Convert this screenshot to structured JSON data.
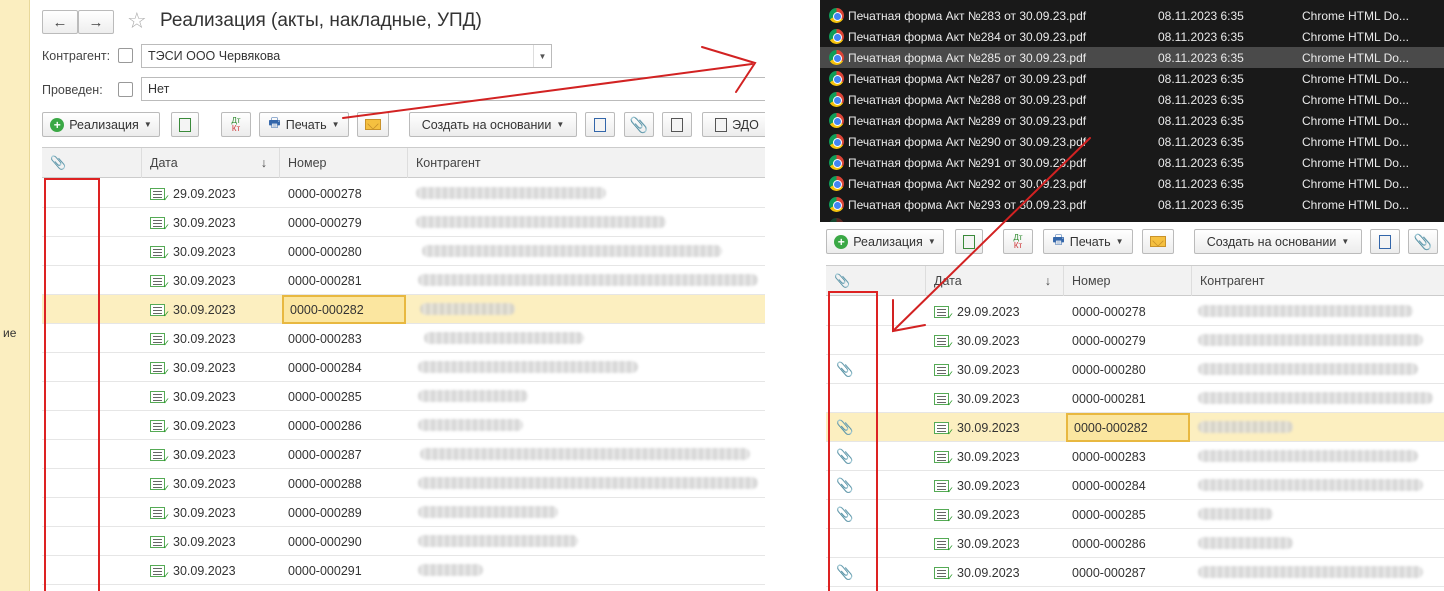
{
  "left": {
    "strip_text": "ие",
    "nav": {
      "back": "←",
      "forward": "→"
    },
    "title": "Реализация (акты, накладные, УПД)",
    "filters": {
      "kontragent_label": "Контрагент:",
      "kontragent_value": "ТЭСИ ООО Червякова",
      "provoden_label": "Проведен:",
      "provoden_value": "Нет"
    },
    "toolbar": {
      "realization": "Реализация",
      "dt": "Дт",
      "kt": "Кт",
      "print": "Печать",
      "create_basis": "Создать на основании",
      "edo": "ЭДО"
    },
    "columns": {
      "date": "Дата",
      "sort_arrow": "↓",
      "number": "Номер",
      "kontragent": "Контрагент"
    },
    "rows": [
      {
        "date": "29.09.2023",
        "number": "0000-000278"
      },
      {
        "date": "30.09.2023",
        "number": "0000-000279"
      },
      {
        "date": "30.09.2023",
        "number": "0000-000280"
      },
      {
        "date": "30.09.2023",
        "number": "0000-000281"
      },
      {
        "date": "30.09.2023",
        "number": "0000-000282"
      },
      {
        "date": "30.09.2023",
        "number": "0000-000283"
      },
      {
        "date": "30.09.2023",
        "number": "0000-000284"
      },
      {
        "date": "30.09.2023",
        "number": "0000-000285"
      },
      {
        "date": "30.09.2023",
        "number": "0000-000286"
      },
      {
        "date": "30.09.2023",
        "number": "0000-000287"
      },
      {
        "date": "30.09.2023",
        "number": "0000-000288"
      },
      {
        "date": "30.09.2023",
        "number": "0000-000289"
      },
      {
        "date": "30.09.2023",
        "number": "0000-000290"
      },
      {
        "date": "30.09.2023",
        "number": "0000-000291"
      }
    ],
    "selected_row_index": 4
  },
  "files": [
    {
      "name": "Печатная форма Акт №283 от 30.09.23.pdf",
      "date": "08.11.2023 6:35",
      "type": "Chrome HTML Do..."
    },
    {
      "name": "Печатная форма Акт №284 от 30.09.23.pdf",
      "date": "08.11.2023 6:35",
      "type": "Chrome HTML Do..."
    },
    {
      "name": "Печатная форма Акт №285 от 30.09.23.pdf",
      "date": "08.11.2023 6:35",
      "type": "Chrome HTML Do..."
    },
    {
      "name": "Печатная форма Акт №287 от 30.09.23.pdf",
      "date": "08.11.2023 6:35",
      "type": "Chrome HTML Do..."
    },
    {
      "name": "Печатная форма Акт №288 от 30.09.23.pdf",
      "date": "08.11.2023 6:35",
      "type": "Chrome HTML Do..."
    },
    {
      "name": "Печатная форма Акт №289 от 30.09.23.pdf",
      "date": "08.11.2023 6:35",
      "type": "Chrome HTML Do..."
    },
    {
      "name": "Печатная форма Акт №290 от 30.09.23.pdf",
      "date": "08.11.2023 6:35",
      "type": "Chrome HTML Do..."
    },
    {
      "name": "Печатная форма Акт №291 от 30.09.23.pdf",
      "date": "08.11.2023 6:35",
      "type": "Chrome HTML Do..."
    },
    {
      "name": "Печатная форма Акт №292 от 30.09.23.pdf",
      "date": "08.11.2023 6:35",
      "type": "Chrome HTML Do..."
    },
    {
      "name": "Печатная форма Акт №293 от 30.09.23.pdf",
      "date": "08.11.2023 6:35",
      "type": "Chrome HTML Do..."
    }
  ],
  "highlighted_file_index": 2,
  "right": {
    "toolbar": {
      "realization": "Реализация",
      "dt": "Дт",
      "kt": "Кт",
      "print": "Печать",
      "create_basis": "Создать на основании"
    },
    "columns": {
      "date": "Дата",
      "sort_arrow": "↓",
      "number": "Номер",
      "kontragent": "Контрагент"
    },
    "rows": [
      {
        "date": "29.09.2023",
        "number": "0000-000278",
        "attached": false
      },
      {
        "date": "30.09.2023",
        "number": "0000-000279",
        "attached": false
      },
      {
        "date": "30.09.2023",
        "number": "0000-000280",
        "attached": true
      },
      {
        "date": "30.09.2023",
        "number": "0000-000281",
        "attached": false
      },
      {
        "date": "30.09.2023",
        "number": "0000-000282",
        "attached": true
      },
      {
        "date": "30.09.2023",
        "number": "0000-000283",
        "attached": true
      },
      {
        "date": "30.09.2023",
        "number": "0000-000284",
        "attached": true
      },
      {
        "date": "30.09.2023",
        "number": "0000-000285",
        "attached": true
      },
      {
        "date": "30.09.2023",
        "number": "0000-000286",
        "attached": false
      },
      {
        "date": "30.09.2023",
        "number": "0000-000287",
        "attached": true
      }
    ],
    "selected_row_index": 4
  },
  "colors": {
    "selection": "#fcefc0",
    "selected_cell_border": "#e8b840",
    "annotation_red": "#d22222",
    "accent_green": "#3aa845"
  }
}
